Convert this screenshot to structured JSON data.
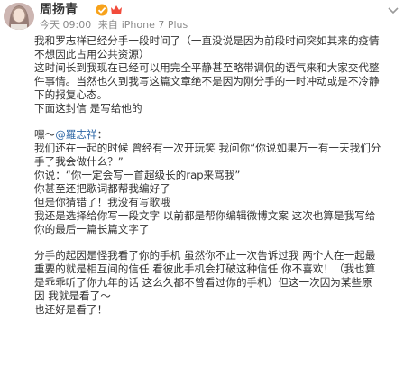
{
  "header": {
    "username": "周扬青",
    "time": "今天 09:00",
    "source_prefix": "来自",
    "source": "iPhone 7 Plus"
  },
  "post": {
    "para1": [
      "我和罗志祥已经分手一段时间了（一直没说是因为前段时间突如其来的疫情",
      "不想因此占用公共资源）",
      "这时间长到我现在已经可以用完全平静甚至略带调侃的语气来和大家交代整",
      "件事情。当然也久到我写这篇文章绝不是因为刚分手的一时冲动或是不冷静",
      "下的报复心态。",
      "下面这封信 是写给他的"
    ],
    "greeting_prefix": "嘿～",
    "mention": "@羅志祥",
    "greeting_suffix": "：",
    "para2": [
      "我们还在一起的时候 曾经有一次开玩笑 我问你“你说如果万一有一天我们分",
      "手了我会做什么？”",
      "你说：“你一定会写一首超级长的rap来骂我”",
      "你甚至还把歌词都帮我编好了",
      "但是你猜错了！我没有写歌哦",
      "我还是选择给你写一段文字 以前都是帮你编辑微博文案 这次也算是我写给",
      "你的最后一篇长篇文字了"
    ],
    "para3": [
      "分手的起因是怪我看了你的手机 虽然你不止一次告诉过我 两个人在一起最",
      "重要的就是相互间的信任 看彼此手机会打破这种信任 你不喜欢！（我也算",
      "是乖乖听了你九年的话 这么久都不曾看过你的手机）但这一次因为某些原",
      "因 我就是看了～",
      "也还好是看了！"
    ]
  },
  "colors": {
    "mention": "#2a64a4",
    "meta": "#8a8a8a",
    "verified": "#f7a21b",
    "vip": "#f24b3b"
  },
  "icons": [
    "avatar",
    "verified-icon",
    "vip-icon",
    "chevron-down-icon"
  ]
}
